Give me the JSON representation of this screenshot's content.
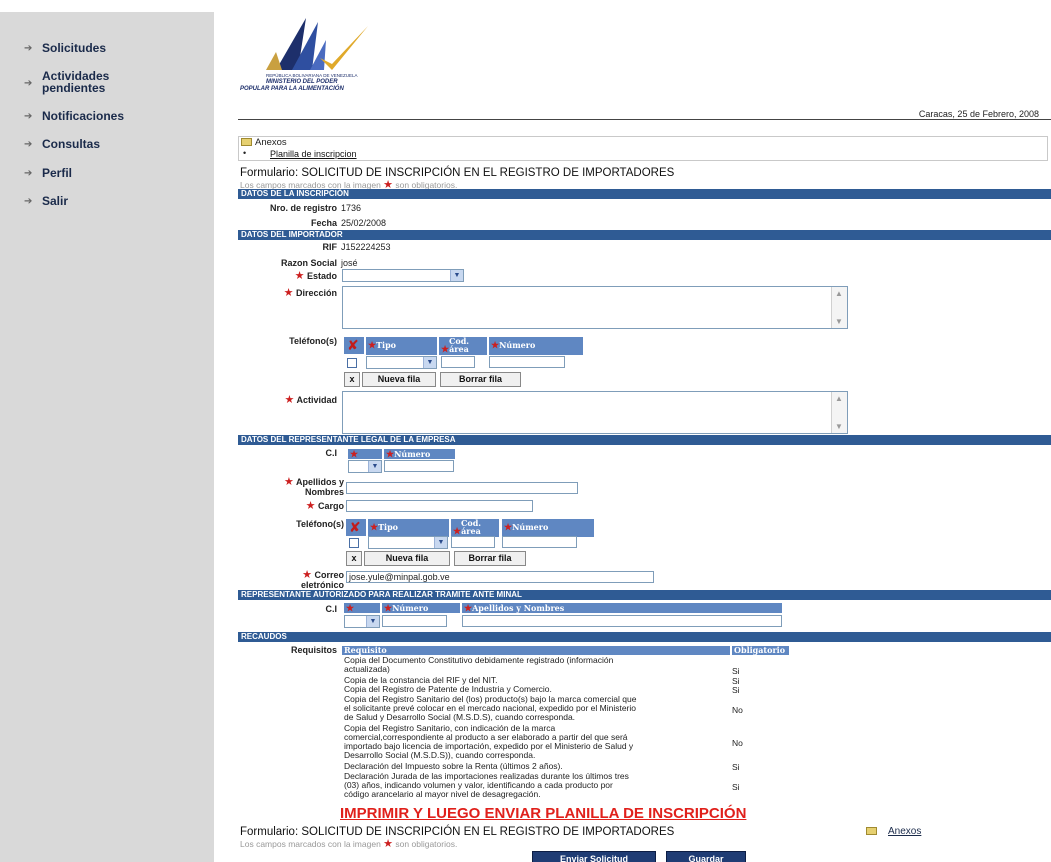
{
  "sidebar": {
    "items": [
      {
        "label": "Solicitudes"
      },
      {
        "label": "Actividades pendientes",
        "line1": "Actividades",
        "line2": "pendientes"
      },
      {
        "label": "Notificaciones"
      },
      {
        "label": "Consultas"
      },
      {
        "label": "Perfil"
      },
      {
        "label": "Salir"
      }
    ]
  },
  "header": {
    "logo_line1": "REPÚBLICA BOLIVARIANA DE VENEZUELA",
    "logo_line2": "MINISTERIO DEL PODER",
    "logo_line3": "POPULAR PARA LA ALIMENTACIÓN",
    "date": "Caracas, 25 de Febrero, 2008"
  },
  "anexos": {
    "title": "Anexos",
    "link": "Planilla de inscripcion"
  },
  "form": {
    "title": "Formulario: SOLICITUD DE INSCRIPCIÓN EN EL REGISTRO DE IMPORTADORES",
    "required_note_a": "Los campos marcados con la imagen",
    "required_note_b": "son obligatorios."
  },
  "inscripcion": {
    "header": "DATOS DE LA INSCRIPCIÓN",
    "nro_label": "Nro. de registro",
    "nro_value": "1736",
    "fecha_label": "Fecha",
    "fecha_value": "25/02/2008"
  },
  "importador": {
    "header": "DATOS DEL IMPORTADOR",
    "rif_label": "RIF",
    "rif_value": "J152224253",
    "razon_label": "Razon Social",
    "razon_value": "josé",
    "estado_label": "Estado",
    "direccion_label": "Dirección",
    "telefonos_label": "Teléfono(s)",
    "tipo_header": "Tipo",
    "cod_header_1": "Cod.",
    "cod_header_2": "área",
    "numero_header": "Número",
    "x_button": "x",
    "nueva_fila": "Nueva fila",
    "borrar_fila": "Borrar fila",
    "actividad_label": "Actividad"
  },
  "representante": {
    "header": "DATOS DEL REPRESENTANTE LEGAL DE LA EMPRESA",
    "ci_label": "C.I",
    "numero_header": "Número",
    "apellidos_label_1": "Apellidos y",
    "apellidos_label_2": "Nombres",
    "cargo_label": "Cargo",
    "telefonos_label": "Teléfono(s)",
    "tipo_header": "Tipo",
    "cod_header_1": "Cod.",
    "cod_header_2": "área",
    "numero_header_2": "Número",
    "x_button": "x",
    "nueva_fila": "Nueva fila",
    "borrar_fila": "Borrar fila",
    "correo_label_1": "Correo",
    "correo_label_2": "eletrónico",
    "correo_value": "jose.yule@minpal.gob.ve"
  },
  "autorizado": {
    "header": "REPRESENTANTE AUTORIZADO PARA REALIZAR TRAMITE ANTE MINAL",
    "ci_label": "C.I",
    "numero_header": "Número",
    "apellidos_header": "Apellidos y Nombres"
  },
  "recaudos": {
    "header": "RECAUDOS",
    "requisitos_label": "Requisitos",
    "col_requisito": "Requisito",
    "col_obligatorio": "Obligatorio",
    "rows": [
      {
        "l1": "Copia del Documento Constitutivo debidamente registrado (información",
        "l2": "actualizada)",
        "l3": "",
        "l4": "",
        "obl": "Si"
      },
      {
        "l1": "Copia de la constancia del RIF y del NIT.",
        "l2": "",
        "l3": "",
        "l4": "",
        "obl": "Si"
      },
      {
        "l1": "Copia del Registro de Patente de Industria y Comercio.",
        "l2": "",
        "l3": "",
        "l4": "",
        "obl": "Si"
      },
      {
        "l1": "Copia del Registro Sanitario del (los) producto(s) bajo la marca comercial que",
        "l2": "el solicitante prevé colocar en el mercado nacional, expedido por el Ministerio",
        "l3": "de Salud y Desarrollo Social (M.S.D.S), cuando corresponda.",
        "l4": "",
        "obl": "No"
      },
      {
        "l1": "Copia del Registro Sanitario, con indicación de la marca",
        "l2": "comercial,correspondiente al producto a ser elaborado a partir del que será",
        "l3": "importado bajo licencia de importación, expedido por el Ministerio de Salud y",
        "l4": "Desarrollo Social (M.S.D.S)), cuando corresponda.",
        "obl": "No"
      },
      {
        "l1": "Declaración del Impuesto sobre la Renta (últimos 2 años).",
        "l2": "",
        "l3": "",
        "l4": "",
        "obl": "Si"
      },
      {
        "l1": "Declaración Jurada de las importaciones realizadas durante los últimos tres",
        "l2": "(03) años, indicando volumen y valor, identificando a cada producto por",
        "l3": "código arancelario al mayor nivel de desagregación.",
        "l4": "",
        "obl": "Si"
      }
    ]
  },
  "footer": {
    "print_notice": "IMPRIMIR Y LUEGO ENVIAR PLANILLA DE INSCRIPCIÓN",
    "form_title": "Formulario: SOLICITUD DE INSCRIPCIÓN EN EL REGISTRO DE IMPORTADORES",
    "anexos_link": "Anexos",
    "required_note_a": "Los campos marcados con la imagen",
    "required_note_b": "son obligatorios.",
    "enviar": "Enviar Solicitud",
    "guardar": "Guardar"
  },
  "colors": {
    "section_bar": "#2f5b94",
    "table_header": "#5f87c2",
    "required_star": "#cc1f1f",
    "print_notice": "#e0201b",
    "sidebar": "#d9d9d9"
  }
}
